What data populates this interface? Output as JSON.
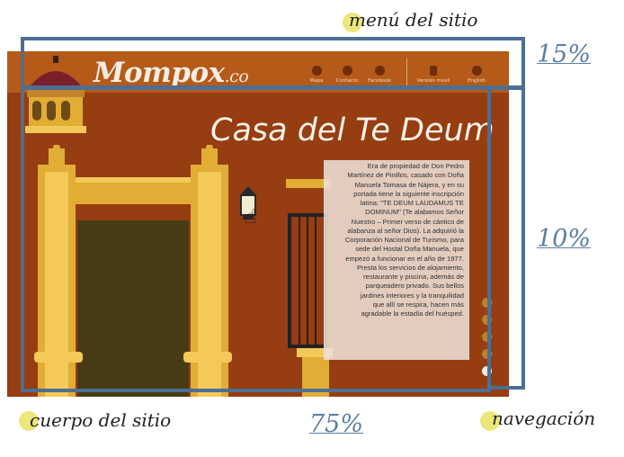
{
  "labels": {
    "menu": "menú del sitio",
    "body": "cuerpo del sitio",
    "nav": "navegación"
  },
  "percentages": {
    "top": "15%",
    "middle": "10%",
    "bottom": "75%"
  },
  "site": {
    "logo_main": "Mompox",
    "logo_suffix": ".co",
    "nav_items": [
      "Mapa",
      "Contacto",
      "Facebook",
      "Version movil",
      "English"
    ],
    "page_title": "Casa del Te Deum",
    "description_lines": [
      "Era de propiedad de Don Pedro",
      "Martínez de Pinillos, casado con Doña",
      "Manuela Tomasa de Nájera, y en su",
      "portada tiene la siguiente inscripción",
      "latina: \"TE DEUM LAUDAMUS TE",
      "DOMINUM\" (Te alabamos Señor",
      "Nuestro – Primer verso de cántico de",
      "alabanza al señor Dios). La adquirió la",
      "Corporación Nacional de Turismo, para",
      "sede del Hostal Doña Manuela, que",
      "empezó a funcionar en el año de 1977.",
      "Presta los servicios de alojamiento,",
      "restaurante y piscina, además de",
      "parqueadero privado. Sus bellos",
      "jardines interiores y la tranquilidad",
      "que allí se respira, hacen más",
      "agradable la estadía del huésped."
    ]
  },
  "colors": {
    "frame": "#4c6f93",
    "highlight": "#ece77a",
    "site_bg": "#963d12",
    "header_bg": "#b55a18",
    "gold": "#e2ad35"
  }
}
